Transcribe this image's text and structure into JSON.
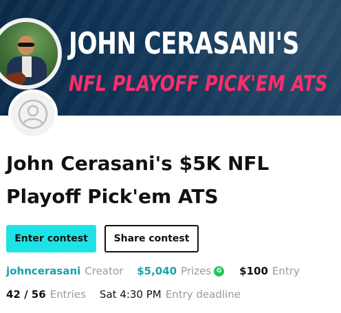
{
  "banner": {
    "title": "JOHN CERASANI'S",
    "subtitle": "NFL PLAYOFF PICK'EM ATS"
  },
  "contest": {
    "title": "John Cerasani's $5K NFL Playoff Pick'em ATS"
  },
  "actions": {
    "enter_label": "Enter contest",
    "share_label": "Share contest"
  },
  "meta": {
    "creator_name": "johncerasani",
    "creator_label": "Creator",
    "prizes_value": "$5,040",
    "prizes_label": "Prizes",
    "prize_badge": "G",
    "entry_value": "$100",
    "entry_label": "Entry",
    "entries_count": "42 / 56",
    "entries_label": "Entries",
    "deadline_value": "Sat 4:30 PM",
    "deadline_label": "Entry deadline"
  },
  "colors": {
    "accent": "#1ee3e6",
    "link": "#14a3a8",
    "banner_sub": "#ff2d6a",
    "badge": "#22c55e"
  },
  "icons": {
    "avatar": "user-icon"
  }
}
